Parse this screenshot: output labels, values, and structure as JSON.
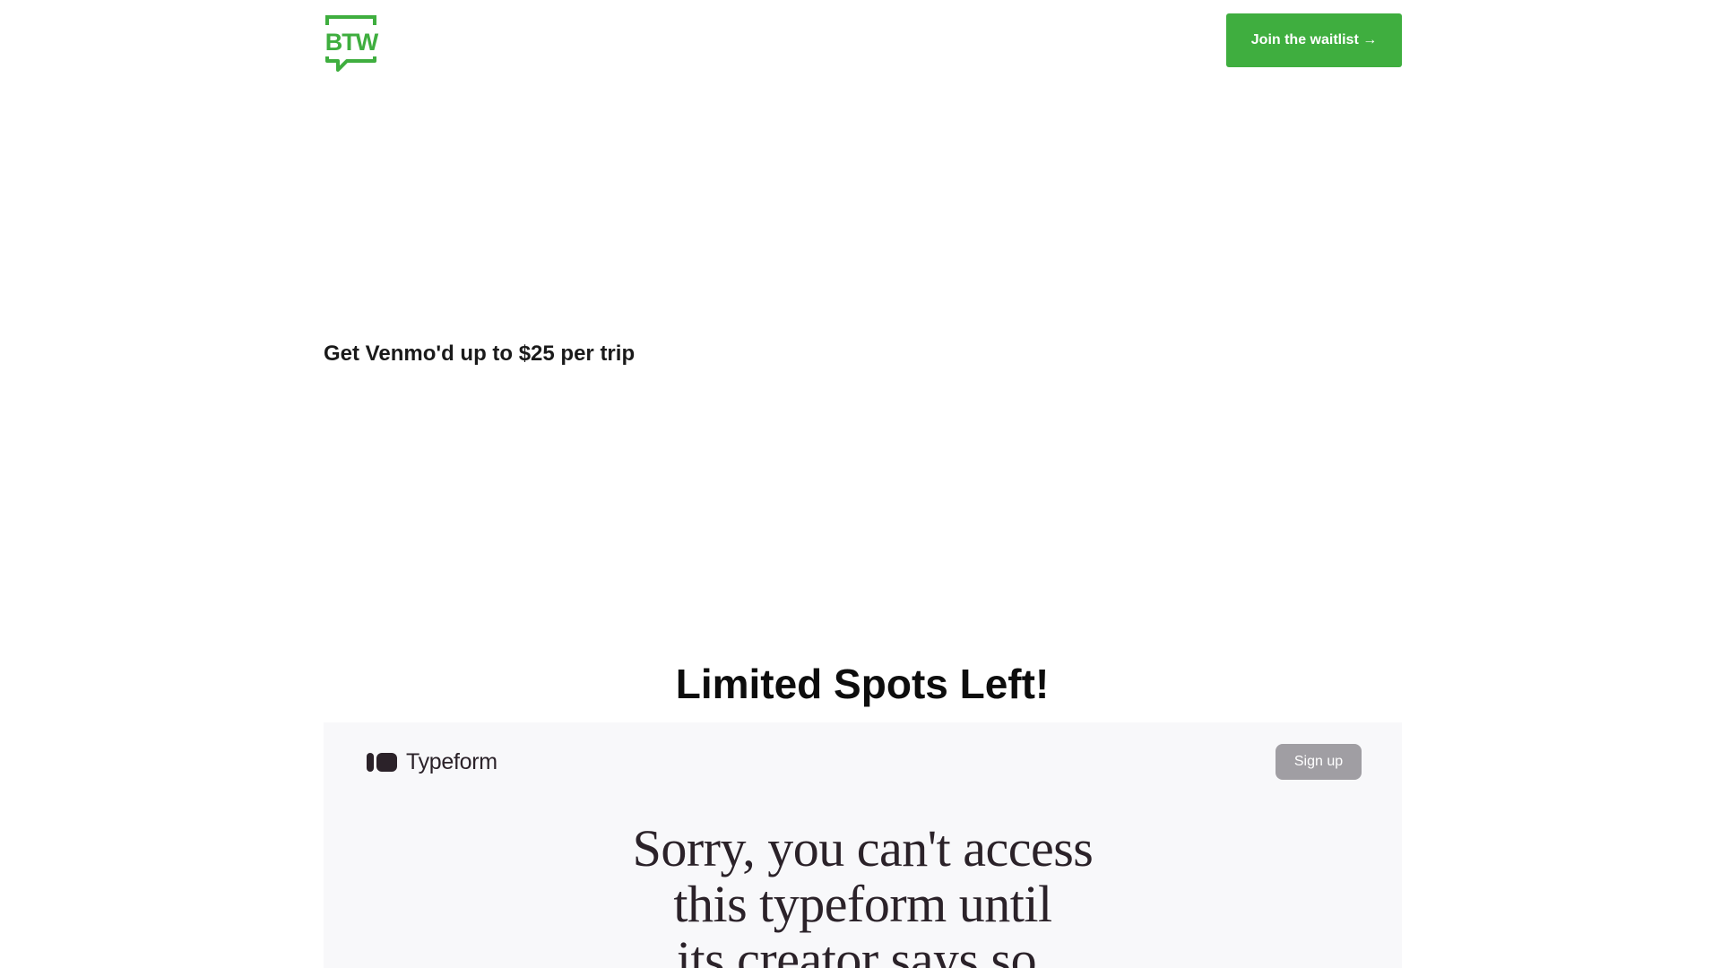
{
  "header": {
    "logo_text": "BTW",
    "cta_label": "Join the waitlist →"
  },
  "hero": {
    "subheading": "Get Venmo'd up to $25 per trip"
  },
  "waitlist_section": {
    "heading": "Limited Spots Left!"
  },
  "typeform_embed": {
    "brand_name": "Typeform",
    "signup_label": "Sign up",
    "message_lines": [
      "Sorry, you can't access",
      "this typeform until",
      "its creator says so."
    ]
  },
  "colors": {
    "brand_green": "#3fae3f",
    "typeform_dark": "#2b2229",
    "signup_gray": "#a09ea3",
    "embed_bg": "#f8f8fa"
  }
}
